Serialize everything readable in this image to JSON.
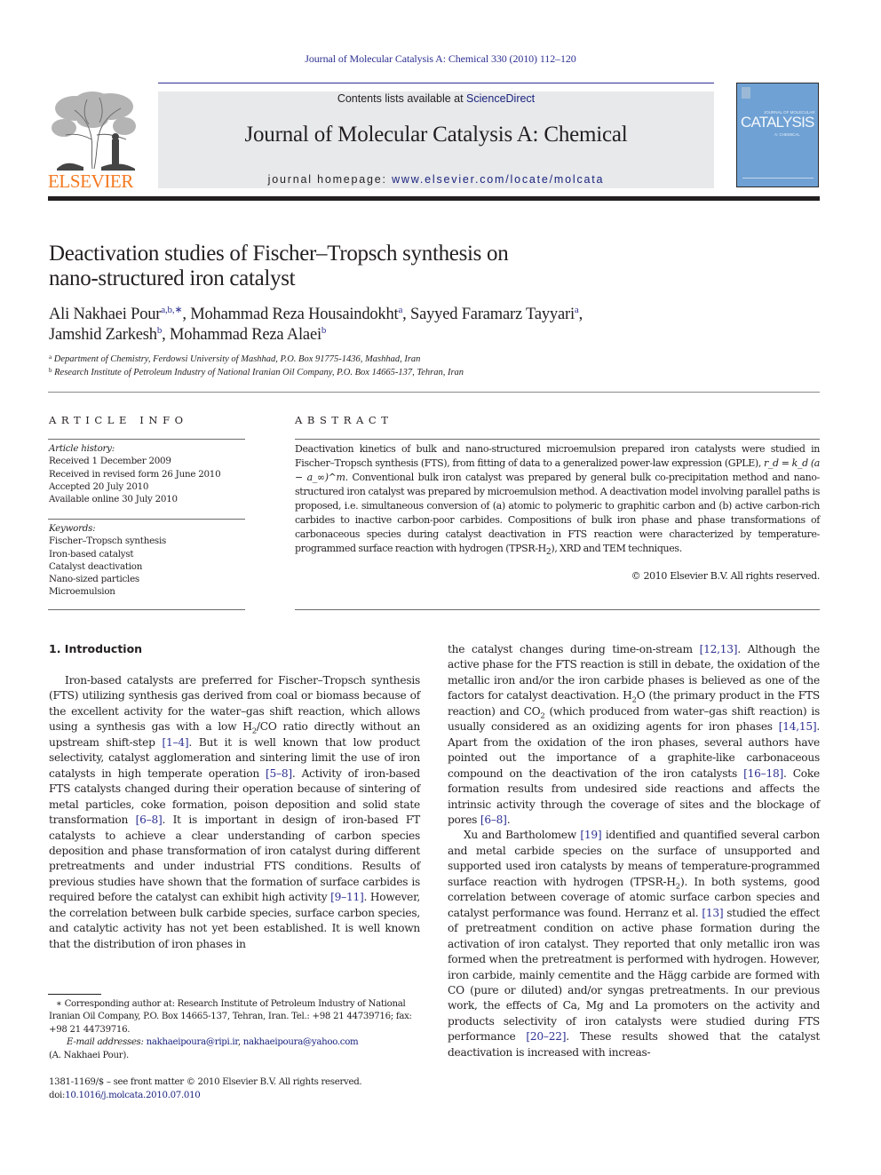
{
  "running_head": "Journal of Molecular Catalysis A: Chemical 330 (2010) 112–120",
  "masthead": {
    "publisher_wordmark": "ELSEVIER",
    "contents_prefix": "Contents lists available at ",
    "contents_link": "ScienceDirect",
    "journal_name": "Journal of Molecular Catalysis A: Chemical",
    "homepage_prefix": "journal homepage: ",
    "homepage_link": "www.elsevier.com/locate/molcata",
    "cover": {
      "small_title": "JOURNAL OF MOLECULAR",
      "word": "CATALYSIS",
      "subtitle": "A: CHEMICAL"
    },
    "colors": {
      "brand_orange": "#f47920",
      "link_blue": "#2e3192",
      "cover_blue": "#6fa1d4",
      "header_grey": "#e8e9eb"
    }
  },
  "article": {
    "title_line1": "Deactivation studies of Fischer–Tropsch synthesis on",
    "title_line2": "nano-structured iron catalyst",
    "authors": [
      {
        "name": "Ali Nakhaei Pour",
        "sup": "a,b,∗",
        "sep": ", "
      },
      {
        "name": "Mohammad Reza Housaindokht",
        "sup": "a",
        "sep": ", "
      },
      {
        "name": "Sayyed Faramarz Tayyari",
        "sup": "a",
        "sep": ","
      },
      {
        "name": "Jamshid Zarkesh",
        "sup": "b",
        "sep": ", "
      },
      {
        "name": "Mohammad Reza Alaei",
        "sup": "b",
        "sep": ""
      }
    ],
    "affiliations": [
      {
        "mark": "a",
        "text": "Department of Chemistry, Ferdowsi University of Mashhad, P.O. Box 91775-1436, Mashhad, Iran"
      },
      {
        "mark": "b",
        "text": "Research Institute of Petroleum Industry of National Iranian Oil Company, P.O. Box 14665-137, Tehran, Iran"
      }
    ]
  },
  "article_info": {
    "heading": "ARTICLE INFO",
    "history_label": "Article history:",
    "history": [
      "Received 1 December 2009",
      "Received in revised form 26 June 2010",
      "Accepted 20 July 2010",
      "Available online 30 July 2010"
    ],
    "keywords_label": "Keywords:",
    "keywords": [
      "Fischer–Tropsch synthesis",
      "Iron-based catalyst",
      "Catalyst deactivation",
      "Nano-sized particles",
      "Microemulsion"
    ]
  },
  "abstract": {
    "heading": "ABSTRACT",
    "part1": "Deactivation kinetics of bulk and nano-structured microemulsion prepared iron catalysts were studied in Fischer–Tropsch synthesis (FTS), from fitting of data to a generalized power-law expression (GPLE), ",
    "formula": "r_d = k_d (a − a_∞)^m",
    "part2": ". Conventional bulk iron catalyst was prepared by general bulk co-precipitation method and nano-structured iron catalyst was prepared by microemulsion method. A deactivation model involving parallel paths is proposed, i.e. simultaneous conversion of (a) atomic to polymeric to graphitic carbon and (b) active carbon-rich carbides to inactive carbon-poor carbides. Compositions of bulk iron phase and phase transformations of carbonaceous species during catalyst deactivation in FTS reaction were characterized by temperature-programmed surface reaction with hydrogen (TPSR-H",
    "part2_sub": "2",
    "part3": "), XRD and TEM techniques.",
    "copyright": "© 2010 Elsevier B.V. All rights reserved."
  },
  "introduction": {
    "heading": "1.  Introduction",
    "left": [
      {
        "t": "Iron-based catalysts are preferred for Fischer–Tropsch synthesis (FTS) utilizing synthesis gas derived from coal or biomass because of the excellent activity for the water–gas shift reaction, which allows using a synthesis gas with a low H"
      },
      {
        "sub": "2"
      },
      {
        "t": "/CO ratio directly without an upstream shift-step "
      },
      {
        "ref": "[1–4]"
      },
      {
        "t": ". But it is well known that low product selectivity, catalyst agglomeration and sintering limit the use of iron catalysts in high temperate operation "
      },
      {
        "ref": "[5–8]"
      },
      {
        "t": ". Activity of iron-based FTS catalysts changed during their operation because of sintering of metal particles, coke formation, poison deposition and solid state transformation "
      },
      {
        "ref": "[6–8]"
      },
      {
        "t": ". It is important in design of iron-based FT catalysts to achieve a clear understanding of carbon species deposition and phase transformation of iron catalyst during different pretreatments and under industrial FTS conditions. Results of previous studies have shown that the formation of surface carbides is required before the catalyst can exhibit high activity "
      },
      {
        "ref": "[9–11]"
      },
      {
        "t": ". However, the correlation between bulk carbide species, surface carbon species, and catalytic activity has not yet been established. It is well known that the distribution of iron phases in"
      }
    ],
    "right_p1": [
      {
        "t": "the catalyst changes during time-on-stream "
      },
      {
        "ref": "[12,13]"
      },
      {
        "t": ". Although the active phase for the FTS reaction is still in debate, the oxidation of the metallic iron and/or the iron carbide phases is believed as one of the factors for catalyst deactivation. H"
      },
      {
        "sub": "2"
      },
      {
        "t": "O (the primary product in the FTS reaction) and CO"
      },
      {
        "sub": "2"
      },
      {
        "t": " (which produced from water–gas shift reaction) is usually considered as an oxidizing agents for iron phases "
      },
      {
        "ref": "[14,15]"
      },
      {
        "t": ". Apart from the oxidation of the iron phases, several authors have pointed out the importance of a graphite-like carbonaceous compound on the deactivation of the iron catalysts "
      },
      {
        "ref": "[16–18]"
      },
      {
        "t": ". Coke formation results from undesired side reactions and affects the intrinsic activity through the coverage of sites and the blockage of pores "
      },
      {
        "ref": "[6–8]"
      },
      {
        "t": "."
      }
    ],
    "right_p2": [
      {
        "t": "Xu and Bartholomew "
      },
      {
        "ref": "[19]"
      },
      {
        "t": " identified and quantified several carbon and metal carbide species on the surface of unsupported and supported used iron catalysts by means of temperature-programmed surface reaction with hydrogen (TPSR-H"
      },
      {
        "sub": "2"
      },
      {
        "t": "). In both systems, good correlation between coverage of atomic surface carbon species and catalyst performance was found. Herranz et al. "
      },
      {
        "ref": "[13]"
      },
      {
        "t": " studied the effect of pretreatment condition on active phase formation during the activation of iron catalyst. They reported that only metallic iron was formed when the pretreatment is performed with hydrogen. However, iron carbide, mainly cementite and the Hägg carbide are formed with CO (pure or diluted) and/or syngas pretreatments. In our previous work, the effects of Ca, Mg and La promoters on the activity and products selectivity of iron catalysts were studied during FTS performance "
      },
      {
        "ref": "[20–22]"
      },
      {
        "t": ". These results showed that the catalyst deactivation is increased with increas-"
      }
    ]
  },
  "footnotes": {
    "corresponding": "∗  Corresponding author at: Research Institute of Petroleum Industry of National Iranian Oil Company, P.O. Box 14665-137, Tehran, Iran. Tel.: +98 21 44739716; fax: +98 21 44739716.",
    "email_label": "E-mail addresses:",
    "email1": "nakhaeipoura@ripi.ir",
    "email_sep": ", ",
    "email2": "nakhaeipoura@yahoo.com",
    "email_owner": "(A. Nakhaei Pour).",
    "front_matter": "1381-1169/$ – see front matter © 2010 Elsevier B.V. All rights reserved.",
    "doi_prefix": "doi:",
    "doi": "10.1016/j.molcata.2010.07.010"
  }
}
